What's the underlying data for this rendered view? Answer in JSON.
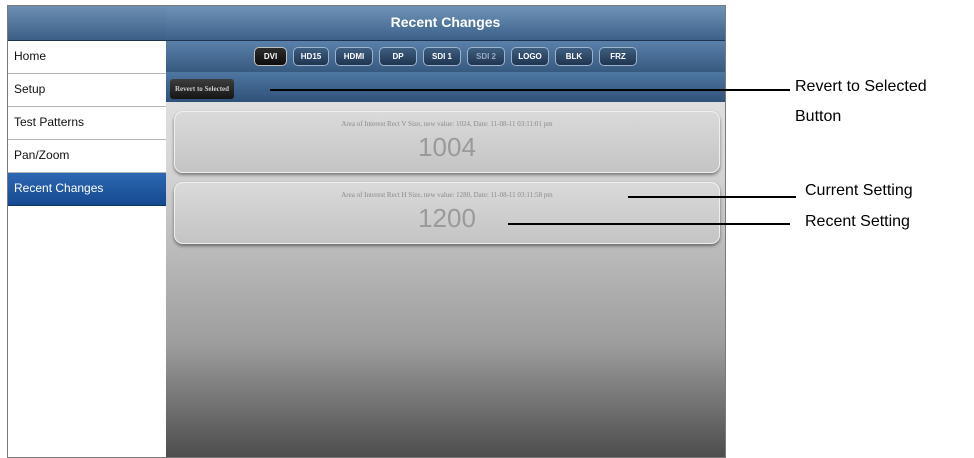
{
  "sidebar": {
    "items": [
      {
        "label": "Home",
        "active": false
      },
      {
        "label": "Setup",
        "active": false
      },
      {
        "label": "Test Patterns",
        "active": false
      },
      {
        "label": "Pan/Zoom",
        "active": false
      },
      {
        "label": "Recent Changes",
        "active": true
      }
    ]
  },
  "header": {
    "title": "Recent Changes"
  },
  "sources": [
    {
      "label": "DVI",
      "active": true
    },
    {
      "label": "HD15",
      "active": false
    },
    {
      "label": "HDMI",
      "active": false
    },
    {
      "label": "DP",
      "active": false
    },
    {
      "label": "SDI 1",
      "active": false
    },
    {
      "label": "SDI 2",
      "active": false
    },
    {
      "label": "LOGO",
      "active": false
    },
    {
      "label": "BLK",
      "active": false
    },
    {
      "label": "FRZ",
      "active": false
    }
  ],
  "revert_button": {
    "label": "Revert to Selected"
  },
  "changes": [
    {
      "description": "Area of Interest Rect V Size, new value: 1024, Date: 11-08-11 03:11:01 pm",
      "value": "1004"
    },
    {
      "description": "Area of Interest Rect H Size, new value: 1280, Date: 11-08-11 03:11:58 pm",
      "value": "1200"
    }
  ],
  "annotations": {
    "revert_line1": "Revert to Selected",
    "revert_line2": "Button",
    "current": "Current Setting",
    "recent": "Recent Setting"
  },
  "colors": {
    "header_blue": "#3c6189",
    "active_nav": "#1e5aa3"
  }
}
